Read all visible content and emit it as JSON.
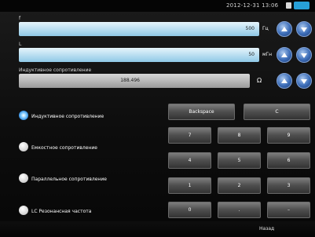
{
  "status": {
    "datetime": "2012-12-31  13:06"
  },
  "fields": {
    "f": {
      "label": "f",
      "value": "500",
      "unit": "Гц"
    },
    "l": {
      "label": "L",
      "value": "50",
      "unit": "мГн"
    },
    "z": {
      "label": "Индуктивное сопротивление",
      "value": "188.496",
      "unit": "Ω"
    }
  },
  "modes": [
    {
      "label": "Индуктивное сопротивление",
      "selected": true
    },
    {
      "label": "Емкостное сопротивление",
      "selected": false
    },
    {
      "label": "Параллельное сопротивление",
      "selected": false
    },
    {
      "label": "LC Резонансная частота",
      "selected": false
    }
  ],
  "keypad": {
    "backspace": "Backspace",
    "clear": "C",
    "keys": [
      "7",
      "8",
      "9",
      "4",
      "5",
      "6",
      "1",
      "2",
      "3",
      "0",
      ".",
      "–"
    ]
  },
  "footer": {
    "back": "Назад"
  },
  "colors": {
    "accent_blue": "#27a0d8",
    "field_blue": "#bfe1f2"
  }
}
